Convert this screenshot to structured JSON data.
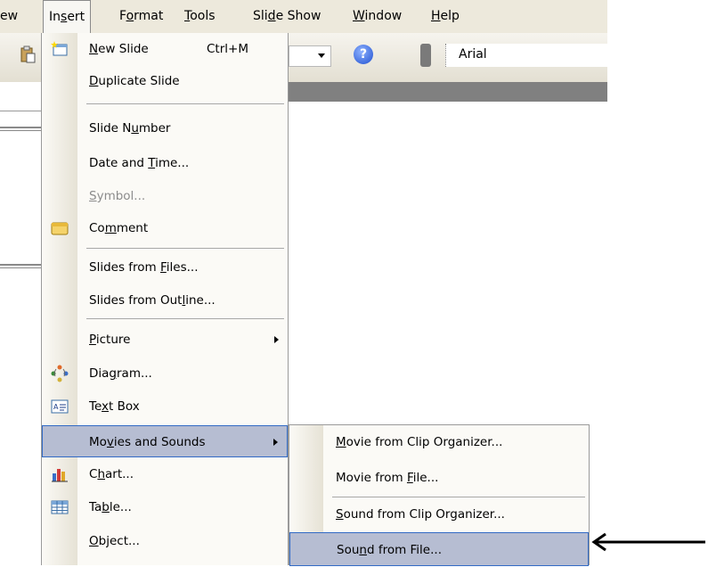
{
  "menubar": {
    "items": [
      {
        "pre": "ew",
        "ul": "",
        "post": ""
      },
      {
        "pre": "In",
        "ul": "s",
        "post": "ert"
      },
      {
        "pre": "F",
        "ul": "o",
        "post": "rmat"
      },
      {
        "pre": "",
        "ul": "T",
        "post": "ools"
      },
      {
        "pre": "Sli",
        "ul": "d",
        "post": "e Show"
      },
      {
        "pre": "",
        "ul": "W",
        "post": "indow"
      },
      {
        "pre": "",
        "ul": "H",
        "post": "elp"
      }
    ]
  },
  "toolbar": {
    "font_name": "Arial"
  },
  "insert_menu": {
    "items": [
      {
        "pre": "",
        "ul": "N",
        "post": "ew Slide",
        "shortcut": "Ctrl+M",
        "icon": "new-slide-icon"
      },
      {
        "pre": "",
        "ul": "D",
        "post": "uplicate Slide"
      },
      {
        "pre": "Slide N",
        "ul": "u",
        "post": "mber"
      },
      {
        "pre": "Date and ",
        "ul": "T",
        "post": "ime..."
      },
      {
        "pre": "",
        "ul": "S",
        "post": "ymbol...",
        "disabled": true
      },
      {
        "pre": "Co",
        "ul": "m",
        "post": "ment",
        "icon": "comment-icon"
      },
      {
        "pre": "Slides from ",
        "ul": "F",
        "post": "iles..."
      },
      {
        "pre": "Slides from Out",
        "ul": "l",
        "post": "ine..."
      },
      {
        "pre": "",
        "ul": "P",
        "post": "icture",
        "submenu": true
      },
      {
        "pre": "Dia",
        "ul": "g",
        "post": "ram...",
        "icon": "diagram-icon"
      },
      {
        "pre": "Te",
        "ul": "x",
        "post": "t Box",
        "icon": "text-box-icon"
      },
      {
        "pre": "Mo",
        "ul": "v",
        "post": "ies and Sounds",
        "submenu": true,
        "highlighted": true
      },
      {
        "pre": "C",
        "ul": "h",
        "post": "art...",
        "icon": "chart-icon"
      },
      {
        "pre": "Ta",
        "ul": "b",
        "post": "le...",
        "icon": "table-icon"
      },
      {
        "pre": "",
        "ul": "O",
        "post": "bject..."
      }
    ]
  },
  "movies_submenu": {
    "items": [
      {
        "pre": "",
        "ul": "M",
        "post": "ovie from Clip Organizer..."
      },
      {
        "pre": "Movie from ",
        "ul": "F",
        "post": "ile..."
      },
      {
        "pre": "",
        "ul": "S",
        "post": "ound from Clip Organizer..."
      },
      {
        "pre": "Sou",
        "ul": "n",
        "post": "d from File...",
        "highlighted": true
      }
    ]
  },
  "colors": {
    "highlight": "#b6bdd2",
    "highlight_border": "#316ac5",
    "menubar_bg": "#ede9dc"
  }
}
